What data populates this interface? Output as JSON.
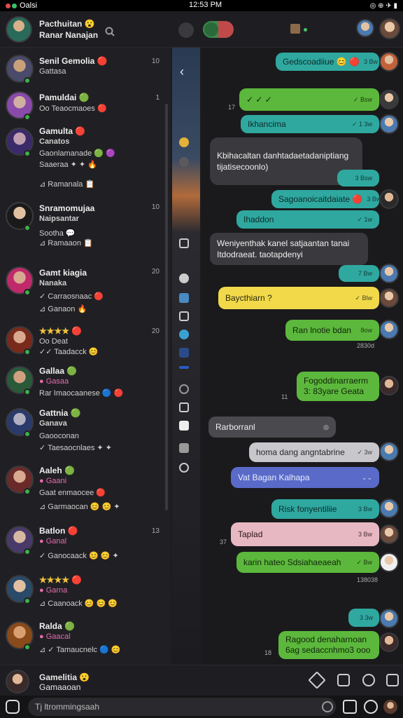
{
  "status": {
    "carrier": "Oalsi",
    "time": "12:53 PM",
    "icons": "◎ ⊕ ✈ ▮"
  },
  "header": {
    "title_line1": "Pacthuitan 😮",
    "title_line2": "Ranar Nanajan",
    "icons": [
      "search-icon",
      "settings-icon",
      "toggle-icon",
      "grid-icon"
    ]
  },
  "chats": [
    {
      "name": "Senil Gemolia 🔴",
      "line1": "Gattasa",
      "line2": "",
      "time": "10"
    },
    {
      "name": "Pamuldai 🟢",
      "line1": "Oo Teaocmaoes 🔴",
      "line2": "",
      "time": "1"
    },
    {
      "name": "Gamulta 🔴",
      "line1": "Canatos",
      "line2": "Gaonlamanade 🟢 🟣",
      "extra": "Saaeraa ✦ ✦ 🔥",
      "extra2": "⊿ Ramanala 📋",
      "time": ""
    },
    {
      "name": "Snramomujaa",
      "line1": "Naipsantar",
      "line2": "",
      "extra": "Sootha 💬",
      "extra2": "⊿ Ramaaon 📋",
      "time": "10"
    },
    {
      "name": "Gamt kiagia",
      "line1": "Nanaka",
      "line2": "✓ Carraosnaac 🔴",
      "extra": "⊿ Ganaon 🔥",
      "time": "20"
    },
    {
      "name": "★★★★ 🔴",
      "line1": "Oo Deat",
      "line2": "✓✓ Taadacck 😊",
      "time": "20"
    },
    {
      "name": "Gallaa 🟢",
      "line1": "● Gasaa",
      "line2": "Rar Imaocaanese 🔵 🔴",
      "time": ""
    },
    {
      "name": "Gattnia 🟢",
      "line1": "Ganava",
      "line2": "Gaooconan",
      "extra": "✓ Taesaocnlaes ✦ ✦",
      "time": ""
    },
    {
      "name": "Aaleh 🟢",
      "line1": "● Gaani",
      "line2": "Gaat enmaocee 🔴",
      "extra": "⊿ Garmaocan 😊 😊 ✦",
      "time": ""
    },
    {
      "name": "Batlon 🔴",
      "line1": "● Ganal",
      "line2": "✓ Ganocaack 😊 😊 ✦",
      "time": "13"
    },
    {
      "name": "★★★★ 🔴",
      "line1": "● Garna",
      "line2": "⊿ Caanoack 😊 😊 😊",
      "time": ""
    },
    {
      "name": "Ralda 🟢",
      "line1": "● Gaacal",
      "line2": "⊿ ✓ Tamaucnelc 🔵 😊",
      "time": ""
    }
  ],
  "messages": [
    {
      "text": "Gedscoadiiue 😊 🔴",
      "meta": "3 Bw",
      "style": "teal"
    },
    {
      "text": "✓ ✓ ✓",
      "meta": "✓ Bsw",
      "style": "green",
      "side": "17"
    },
    {
      "text": "Ikhancima",
      "meta": "✓ 1 3w",
      "style": "teal"
    },
    {
      "text": "Kbihacaltan danhtadaetadaniptiang tijatisecoonlo)",
      "meta": "",
      "style": "gray"
    },
    {
      "text": "",
      "meta": "3 Bsw",
      "style": "teal"
    },
    {
      "text": "Sagoanoicaitdaiate 🔴",
      "meta": "3 Bw",
      "style": "teal"
    },
    {
      "text": "Ihaddon",
      "meta": "✓ 1w",
      "style": "teal"
    },
    {
      "text": "Weniyenthak kanel satjaantan tanai Itdodraeat. taotapdenyi",
      "meta": "",
      "style": "gray"
    },
    {
      "text": "",
      "meta": "7 Bw",
      "style": "teal"
    },
    {
      "text": "Baycthiarn ?",
      "meta": "✓ Blw",
      "style": "yellow"
    },
    {
      "text": "Ran lnotie bdan",
      "meta": "8ow",
      "style": "green",
      "sub": "2830d"
    },
    {
      "text": "Fogoddinarraerm 3: 83yare Geata",
      "meta": "",
      "style": "green",
      "side": "11"
    },
    {
      "text": "Rarborranl",
      "meta": "◎",
      "style": "gray"
    },
    {
      "text": "homa dang angntabrine",
      "meta": "✓ 3w",
      "style": "light"
    },
    {
      "text": "Vat Bagan Kalhapa",
      "meta": "⌄⌄",
      "style": "blue"
    },
    {
      "text": "Risk fonyentiliie",
      "meta": "3 Bw",
      "style": "teal"
    },
    {
      "text": "Taplad",
      "meta": "3 Bw",
      "style": "pink",
      "side": "37"
    },
    {
      "text": "karin hateo Sdsiahaeaeah",
      "meta": "✓ Bw",
      "style": "green",
      "sub": "138038"
    },
    {
      "text": "",
      "meta": "3 3w",
      "style": "teal"
    },
    {
      "text": "Ragood denaharnoan 6ag sedaccnhmo3 ooo",
      "meta": "",
      "style": "green",
      "side": "18"
    }
  ],
  "self": {
    "name": "Gamelitia 😮",
    "sub": "Gamaaoan"
  },
  "input": {
    "placeholder": "Tj  ltrommingsaah"
  },
  "colors": {
    "teal": "#2fa8a0",
    "green": "#5cb83c",
    "yellow": "#f2d94a",
    "pink": "#e8b8c2",
    "blue": "#5a6ac8"
  }
}
